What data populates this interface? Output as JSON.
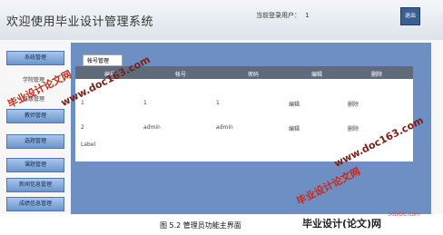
{
  "header": {
    "title": "欢迎使用毕业设计管理系统",
    "user_label": "当前登录用户：",
    "user_value": "1",
    "exit_label": "退出"
  },
  "sidebar": {
    "items": [
      {
        "label": "系统管理"
      },
      {
        "label": "学院管理"
      },
      {
        "label": "班级管理"
      },
      {
        "label": "教师管理"
      },
      {
        "label": "选题管理"
      },
      {
        "label": "课题管理"
      },
      {
        "label": "新闻信息管理"
      },
      {
        "label": "成绩信息管理"
      }
    ]
  },
  "tabs": {
    "active": "帐号管理"
  },
  "table": {
    "headers": [
      "编号",
      "帐号",
      "密码",
      "编辑",
      "删除"
    ],
    "rows": [
      [
        "1",
        "1",
        "1",
        "编辑",
        "删除"
      ],
      [
        "2",
        "admin",
        "admin",
        "编辑",
        "删除"
      ]
    ]
  },
  "label_text": "Label",
  "caption": "图 5.2  管理员功能主界面",
  "watermarks": [
    "毕业设计论文网",
    "www.doc163.com"
  ],
  "brand": "毕业设计(论文)网",
  "badge": "56DOC.com"
}
